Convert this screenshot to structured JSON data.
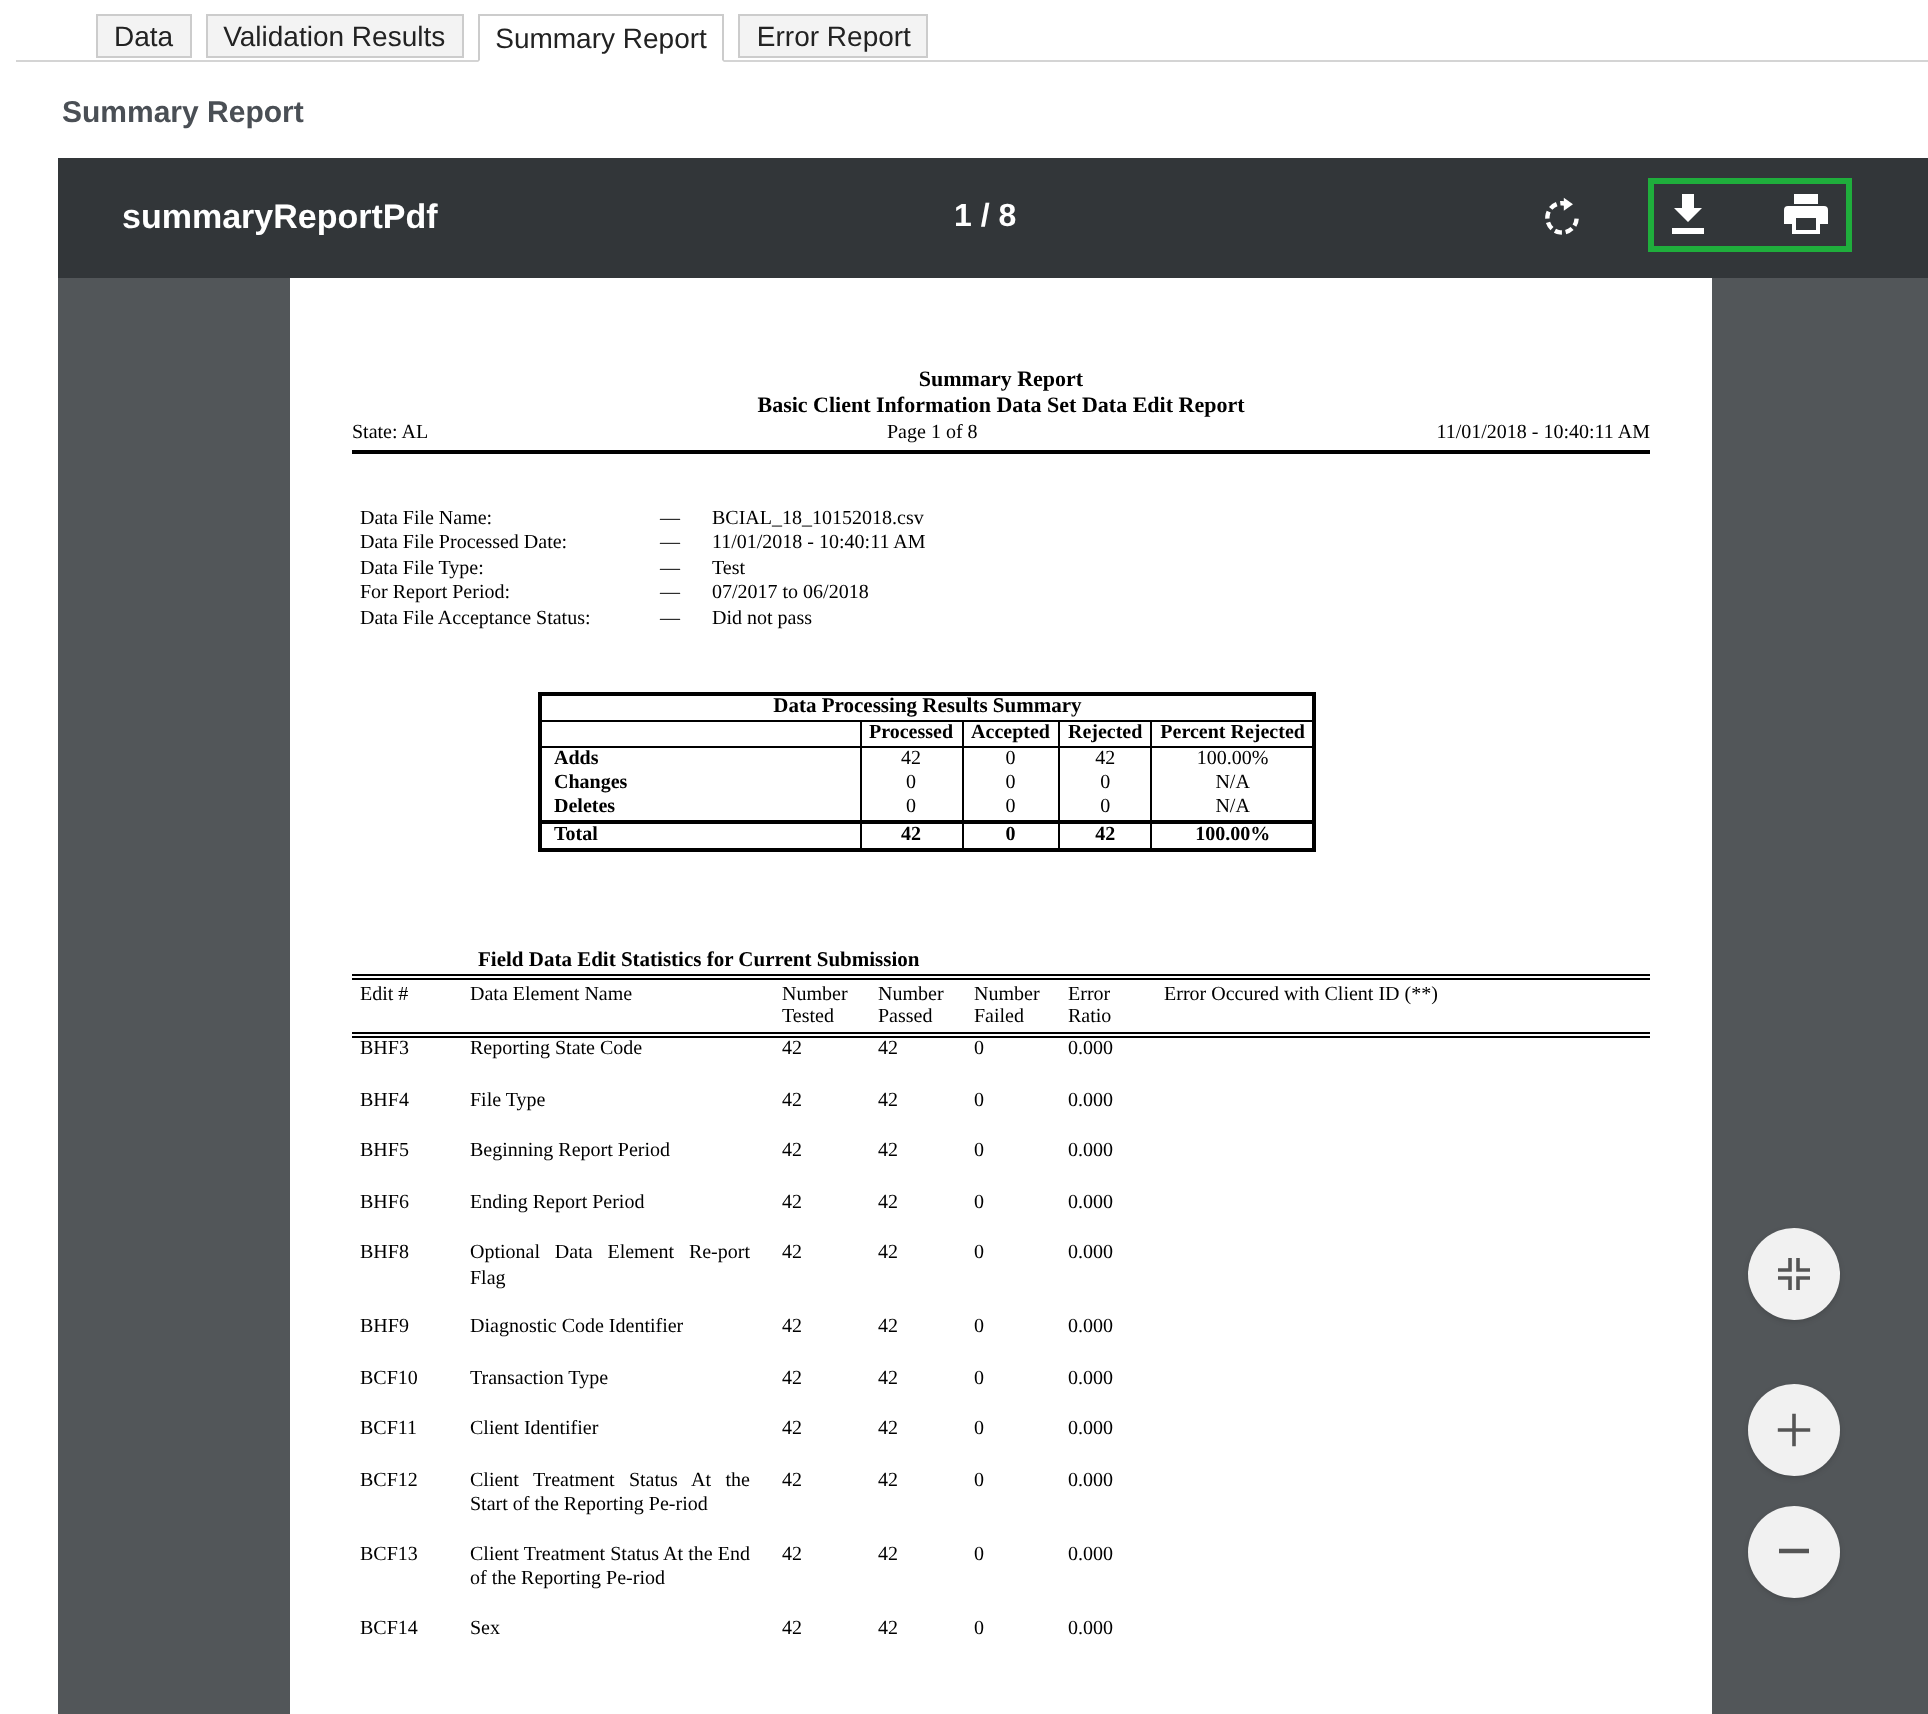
{
  "tabs": [
    {
      "label": "Data",
      "selected": false
    },
    {
      "label": "Validation Results",
      "selected": false
    },
    {
      "label": "Summary Report",
      "selected": true
    },
    {
      "label": "Error Report",
      "selected": false
    }
  ],
  "section_title": "Summary Report",
  "viewer": {
    "title": "summaryReportPdf",
    "page_counter": "1 / 8"
  },
  "document": {
    "title": "Summary Report",
    "subtitle": "Basic Client Information Data Set Data Edit Report",
    "state": "State: AL",
    "page": "Page 1 of 8",
    "timestamp": "11/01/2018 - 10:40:11 AM",
    "file_info": [
      {
        "label": "Data File Name:",
        "dash": "—",
        "value": "BCIAL_18_10152018.csv"
      },
      {
        "label": "Data File Processed Date:",
        "dash": "—",
        "value": "11/01/2018 - 10:40:11 AM"
      },
      {
        "label": "Data File Type:",
        "dash": "—",
        "value": "Test"
      },
      {
        "label": "For Report Period:",
        "dash": "—",
        "value": "07/2017 to 06/2018"
      },
      {
        "label": "Data File Acceptance Status:",
        "dash": "—",
        "value": "Did not pass"
      }
    ],
    "summary_table": {
      "title": "Data Processing Results Summary",
      "columns": [
        "Processed",
        "Accepted",
        "Rejected",
        "Percent Rejected"
      ],
      "rows": [
        {
          "label": "Adds",
          "bold": false,
          "cells": [
            "42",
            "0",
            "42",
            "100.00%"
          ]
        },
        {
          "label": "Changes",
          "bold": false,
          "cells": [
            "0",
            "0",
            "0",
            "N/A"
          ]
        },
        {
          "label": "Deletes",
          "bold": false,
          "cells": [
            "0",
            "0",
            "0",
            "N/A"
          ]
        },
        {
          "label": "Total",
          "bold": true,
          "cells": [
            "42",
            "0",
            "42",
            "100.00%"
          ]
        }
      ]
    },
    "stats_table": {
      "title": "Field Data Edit Statistics for Current Submission",
      "columns": [
        "Edit #",
        "Data Element Name",
        "Number Tested",
        "Number Passed",
        "Number Failed",
        "Error Ratio",
        "Error Occured with Client ID (**)"
      ],
      "rows": [
        [
          "BHF3",
          "Reporting State Code",
          "42",
          "42",
          "0",
          "0.000"
        ],
        [
          "BHF4",
          "File Type",
          "42",
          "42",
          "0",
          "0.000"
        ],
        [
          "BHF5",
          "Beginning Report Period",
          "42",
          "42",
          "0",
          "0.000"
        ],
        [
          "BHF6",
          "Ending Report Period",
          "42",
          "42",
          "0",
          "0.000"
        ],
        [
          "BHF8",
          "Optional Data Element Re-port Flag",
          "42",
          "42",
          "0",
          "0.000"
        ],
        [
          "BHF9",
          "Diagnostic Code Identifier",
          "42",
          "42",
          "0",
          "0.000"
        ],
        [
          "BCF10",
          "Transaction Type",
          "42",
          "42",
          "0",
          "0.000"
        ],
        [
          "BCF11",
          "Client Identifier",
          "42",
          "42",
          "0",
          "0.000"
        ],
        [
          "BCF12",
          "Client Treatment Status At the Start of the Reporting Pe-riod",
          "42",
          "42",
          "0",
          "0.000"
        ],
        [
          "BCF13",
          "Client Treatment Status At the End of the Reporting Pe-riod",
          "42",
          "42",
          "0",
          "0.000"
        ],
        [
          "BCF14",
          "Sex",
          "42",
          "42",
          "0",
          "0.000"
        ]
      ]
    }
  }
}
